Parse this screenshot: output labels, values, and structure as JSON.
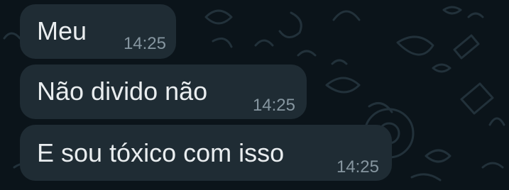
{
  "theme": {
    "background": "#0b141a",
    "bubble_background": "#1f2c34",
    "text_color": "#e9edef",
    "time_color": "#8696a0",
    "doodle_color": "#22313a"
  },
  "messages": [
    {
      "text": "Meu",
      "time": "14:25"
    },
    {
      "text": "Não divido não",
      "time": "14:25"
    },
    {
      "text": "E sou tóxico com isso",
      "time": "14:25"
    }
  ]
}
